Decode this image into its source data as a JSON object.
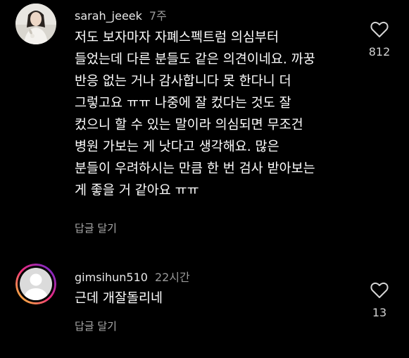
{
  "comments": [
    {
      "username": "sarah_jeeek",
      "time": "7주",
      "lines": [
        "저도 보자마자 자폐스펙트럼 의심부터",
        "들었는데 다른 분들도 같은 의견이네요. 까꿍",
        "반응 없는 거나 감사합니다 못 한다니 더",
        "그렇고요 ㅠㅠ 나중에 잘 컸다는 것도 잘",
        "컸으니 할 수 있는 말이라 의심되면 무조건",
        "병원 가보는 게 낫다고 생각해요. 많은",
        "분들이 우려하시는 만큼 한 번 검사 받아보는",
        "게 좋을 거 같아요 ㅠㅠ"
      ],
      "reply_label": "답글 달기",
      "like_count": "812",
      "like_icon": "heart-outline-icon"
    },
    {
      "username": "gimsihun510",
      "time": "22시간",
      "lines": [
        "근데 개잘돌리네"
      ],
      "reply_label": "답글 달기",
      "like_count": "13",
      "like_icon": "heart-outline-icon"
    }
  ],
  "colors": {
    "background": "#000000",
    "text": "#ffffff",
    "muted": "#9a9a9a",
    "story_ring": [
      "#f9ce34",
      "#ee2a7b",
      "#6228d7"
    ]
  }
}
